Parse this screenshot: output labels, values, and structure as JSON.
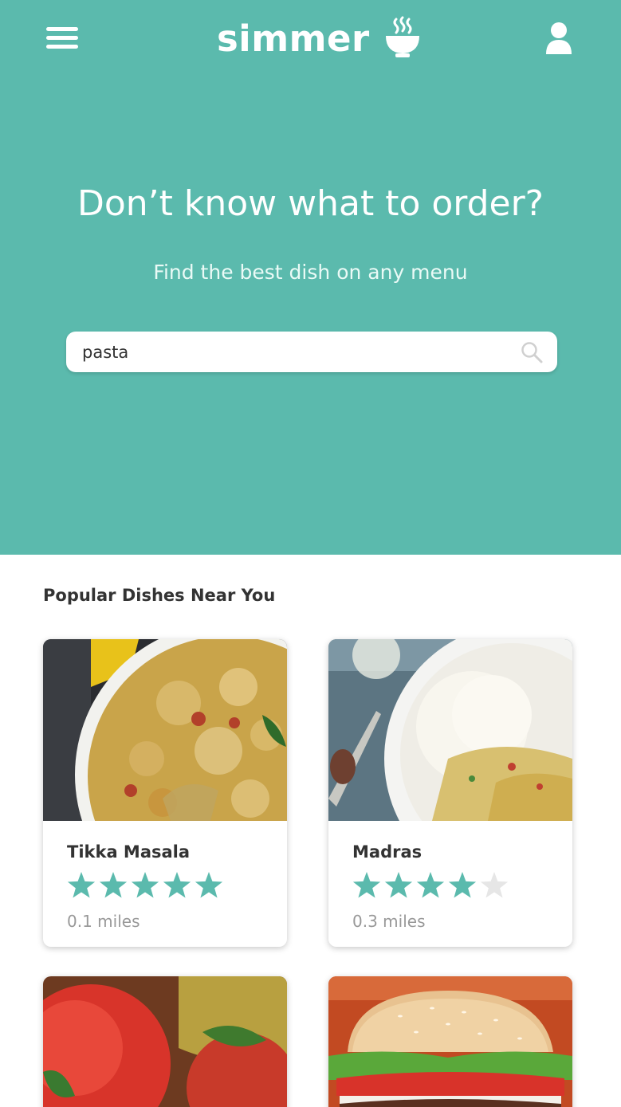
{
  "app": {
    "name": "simmer"
  },
  "hero": {
    "title": "Don’t know what to order?",
    "subtitle": "Find the best dish on any menu"
  },
  "search": {
    "value": "pasta"
  },
  "popular": {
    "title": "Popular Dishes Near You",
    "dishes": [
      {
        "name": "Tikka Masala",
        "rating": 5,
        "max_rating": 5,
        "distance": "0.1 miles"
      },
      {
        "name": "Madras",
        "rating": 4,
        "max_rating": 5,
        "distance": "0.3 miles"
      },
      {
        "name": "",
        "rating": null,
        "max_rating": 5,
        "distance": ""
      },
      {
        "name": "",
        "rating": null,
        "max_rating": 5,
        "distance": ""
      }
    ]
  },
  "colors": {
    "brand_teal": "#5bbaad",
    "star_filled": "#5bbaad",
    "star_empty": "#e6e6e6",
    "muted_text": "#999999"
  },
  "icons": {
    "menu": "hamburger-menu-icon",
    "logo": "steaming-bowl-icon",
    "user": "user-profile-icon",
    "search": "magnifier-icon"
  }
}
